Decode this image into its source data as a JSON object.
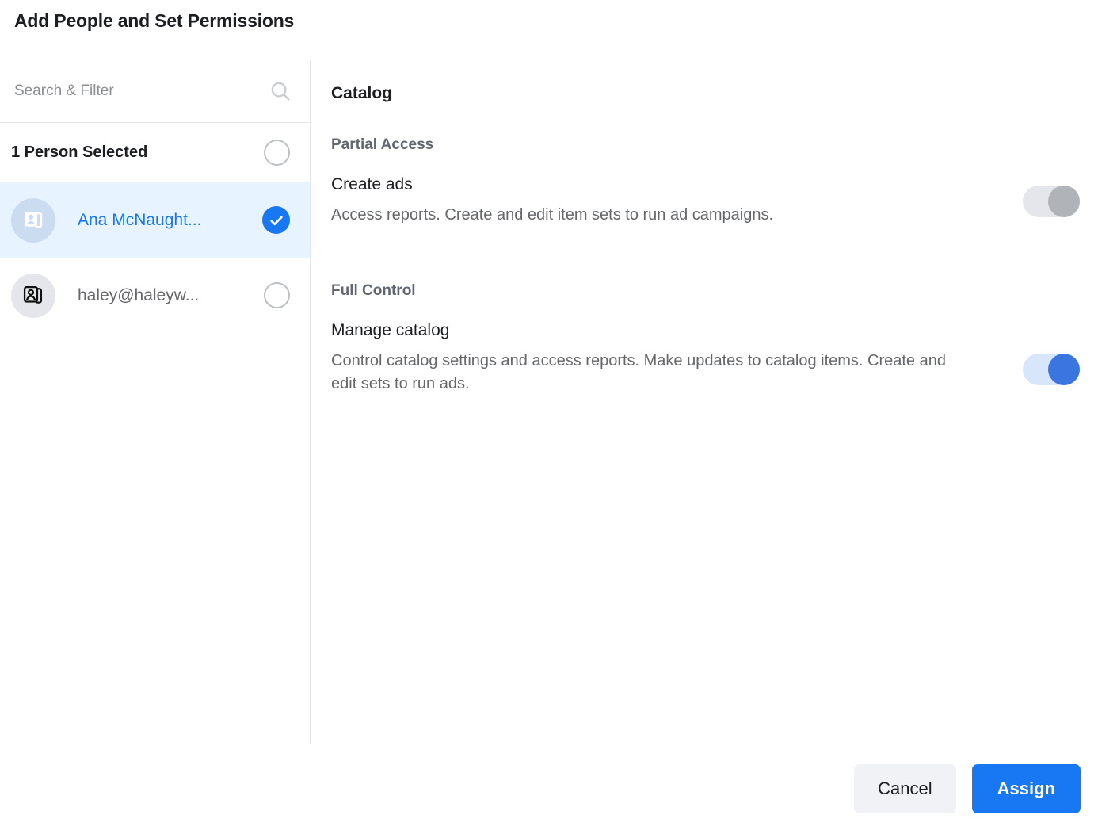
{
  "dialog": {
    "title": "Add People and Set Permissions"
  },
  "search": {
    "placeholder": "Search & Filter",
    "value": "",
    "icon": "search-icon"
  },
  "people_panel": {
    "count_label": "1 Person Selected",
    "select_all_checked": false,
    "people": [
      {
        "name": "Ana McNaught...",
        "selected": true,
        "avatar_icon": "contact-cards-icon",
        "avatar_style": "blue"
      },
      {
        "name": "haley@haleyw...",
        "selected": false,
        "avatar_icon": "contact-cards-icon",
        "avatar_style": "gray"
      }
    ]
  },
  "permissions_panel": {
    "section_title": "Catalog",
    "groups": [
      {
        "heading": "Partial Access",
        "permissions": [
          {
            "name": "Create ads",
            "description": "Access reports. Create and edit item sets to run ad campaigns.",
            "enabled": false
          }
        ]
      },
      {
        "heading": "Full Control",
        "permissions": [
          {
            "name": "Manage catalog",
            "description": "Control catalog settings and access reports. Make updates to catalog items. Create and edit sets to run ads.",
            "enabled": true
          }
        ]
      }
    ]
  },
  "footer": {
    "cancel_label": "Cancel",
    "assign_label": "Assign"
  },
  "colors": {
    "accent_blue": "#1877f2",
    "selected_row_bg": "#e7f3ff",
    "toggle_on_track": "#d8e6fb",
    "toggle_on_knob": "#3b76e0",
    "toggle_off_track": "#e4e6eb",
    "toggle_off_knob": "#b0b3b8",
    "text_primary": "#1c1e21",
    "text_secondary": "#65676b",
    "cancel_bg": "#f0f2f5",
    "divider": "#e4e6eb"
  }
}
